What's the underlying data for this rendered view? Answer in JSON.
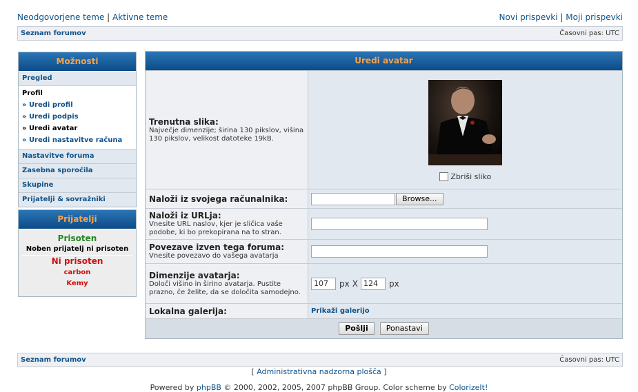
{
  "top": {
    "unanswered": "Neodgovorjene teme",
    "active": "Aktivne teme",
    "new_posts": "Novi prispevki",
    "my_posts": "Moji prispevki",
    "separator": "|"
  },
  "navbar": {
    "index": "Seznam forumov",
    "timezone": "Časovni pas: UTC"
  },
  "options": {
    "title": "Možnosti",
    "overview": "Pregled",
    "profile": {
      "title": "Profil",
      "items": [
        "» Uredi profil",
        "» Uredi podpis",
        "» Uredi avatar",
        "» Uredi nastavitve računa"
      ]
    },
    "board_prefs": "Nastavitve foruma",
    "pm": "Zasebna sporočila",
    "groups": "Skupine",
    "friends_foes": "Prijatelji & sovražniki"
  },
  "friends": {
    "title": "Prijatelji",
    "online_heading": "Prisoten",
    "online_none": "Noben prijatelj ni prisoten",
    "offline_heading": "Ni prisoten",
    "offline": [
      "carbon",
      "Kemy"
    ]
  },
  "form": {
    "title": "Uredi avatar",
    "current": {
      "label": "Trenutna slika:",
      "desc": "Največje dimenzije; širina 130 pikslov, višina 130 pikslov, velikost datoteke 19kB.",
      "delete_label": "Zbriši sliko"
    },
    "upload": {
      "label": "Naloži iz svojega računalnika:",
      "browse": "Browse..."
    },
    "url": {
      "label": "Naloži iz URLja:",
      "desc": "Vnesite URL naslov, kjer je sličica vaše podobe, ki bo prekopirana na to stran.",
      "value": ""
    },
    "remote": {
      "label": "Povezave izven tega foruma:",
      "desc": "Vnesite povezavo do vašega avatarja",
      "value": ""
    },
    "dimensions": {
      "label": "Dimenzije avatarja:",
      "desc": "Določi višino in širino avatarja. Pustite prazno, če želite, da se določita samodejno.",
      "width": "107",
      "height": "124",
      "px": "px",
      "x": "X"
    },
    "gallery": {
      "label": "Lokalna galerija:",
      "link": "Prikaži galerijo"
    },
    "submit": "Pošlji",
    "reset": "Ponastavi"
  },
  "footer": {
    "index": "Seznam forumov",
    "timezone": "Časovni pas: UTC",
    "acp_open": "[ ",
    "acp": "Administrativna nadzorna plošča",
    "acp_close": " ]",
    "powered_prefix": "Powered by ",
    "phpbb": "phpBB",
    "powered_mid": " © 2000, 2002, 2005, 2007 phpBB Group. Color scheme by ",
    "colorizeit": "ColorizeIt!"
  }
}
